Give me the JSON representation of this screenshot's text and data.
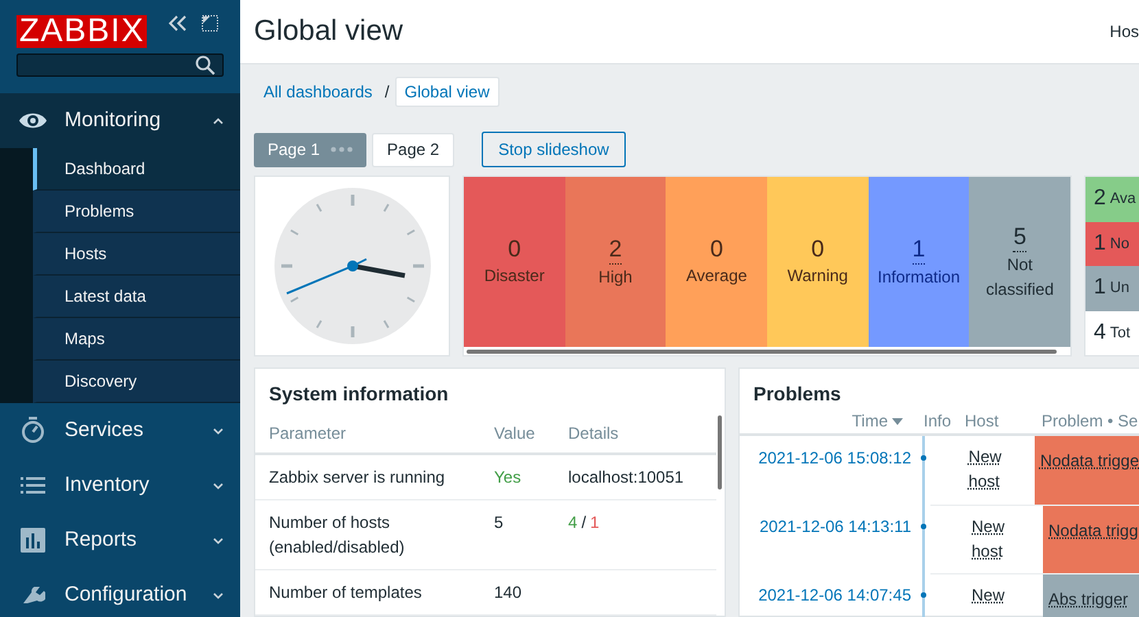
{
  "sidebar": {
    "logo": "ZABBIX",
    "menu": [
      {
        "label": "Monitoring",
        "expanded": true,
        "children": [
          {
            "label": "Dashboard",
            "selected": true
          },
          {
            "label": "Problems",
            "selected": false
          },
          {
            "label": "Hosts",
            "selected": false
          },
          {
            "label": "Latest data",
            "selected": false
          },
          {
            "label": "Maps",
            "selected": false
          },
          {
            "label": "Discovery",
            "selected": false
          }
        ]
      },
      {
        "label": "Services",
        "expanded": false
      },
      {
        "label": "Inventory",
        "expanded": false
      },
      {
        "label": "Reports",
        "expanded": false
      },
      {
        "label": "Configuration",
        "expanded": false
      }
    ]
  },
  "header": {
    "title": "Global view",
    "right_text": "Hos"
  },
  "breadcrumbs": {
    "separator": "/",
    "items": [
      {
        "label": "All dashboards",
        "selected": false
      },
      {
        "label": "Global view",
        "selected": true
      }
    ]
  },
  "pages": [
    {
      "label": "Page 1",
      "selected": true
    },
    {
      "label": "Page 2",
      "selected": false
    }
  ],
  "slideshow_button": "Stop slideshow",
  "severity": [
    {
      "count": "0",
      "label": "Disaster",
      "color": "#e45959"
    },
    {
      "count": "2",
      "label": "High",
      "color": "#e97659"
    },
    {
      "count": "0",
      "label": "Average",
      "color": "#ffa059"
    },
    {
      "count": "0",
      "label": "Warning",
      "color": "#ffc859"
    },
    {
      "count": "1",
      "label": "Information",
      "color": "#7499ff"
    },
    {
      "count": "5",
      "label": "Not classified",
      "color": "#97aab3"
    }
  ],
  "host_availability": [
    {
      "count": "2",
      "label": "Ava",
      "color": "#86cc89"
    },
    {
      "count": "1",
      "label": "No",
      "color": "#e45959"
    },
    {
      "count": "1",
      "label": "Un",
      "color": "#97aab3"
    },
    {
      "count": "4",
      "label": "Tot",
      "color": "#ffffff"
    }
  ],
  "system_information": {
    "title": "System information",
    "columns": [
      "Parameter",
      "Value",
      "Details"
    ],
    "rows": [
      {
        "parameter": "Zabbix server is running",
        "value": {
          "text": "Yes",
          "kind": "ok"
        },
        "details": [
          {
            "text": "localhost:10051",
            "kind": "plain"
          }
        ]
      },
      {
        "parameter": "Number of hosts (enabled/disabled)",
        "value": {
          "text": "5",
          "kind": "plain"
        },
        "details": [
          {
            "text": "4",
            "kind": "ok"
          },
          {
            "text": "/",
            "kind": "plain"
          },
          {
            "text": "1",
            "kind": "bad"
          }
        ]
      },
      {
        "parameter": "Number of templates",
        "value": {
          "text": "140",
          "kind": "plain"
        },
        "details": []
      }
    ]
  },
  "problems": {
    "title": "Problems",
    "columns": [
      {
        "label": "Time",
        "sorted": true
      },
      {
        "label": "Info",
        "sorted": false
      },
      {
        "label": "Host",
        "sorted": false
      },
      {
        "label": "Problem • Se",
        "sorted": false
      }
    ],
    "rows": [
      {
        "time": "2021-12-06 15:08:12",
        "host": "New host",
        "problem": "Nodata trigge",
        "color": "#e97659"
      },
      {
        "time": "2021-12-06 14:13:11",
        "host": "New host",
        "problem": "Nodata trigg",
        "color": "#e97659"
      },
      {
        "time": "2021-12-06 14:07:45",
        "host": "New",
        "problem": "Abs trigger",
        "color": "#97aab3"
      }
    ]
  }
}
